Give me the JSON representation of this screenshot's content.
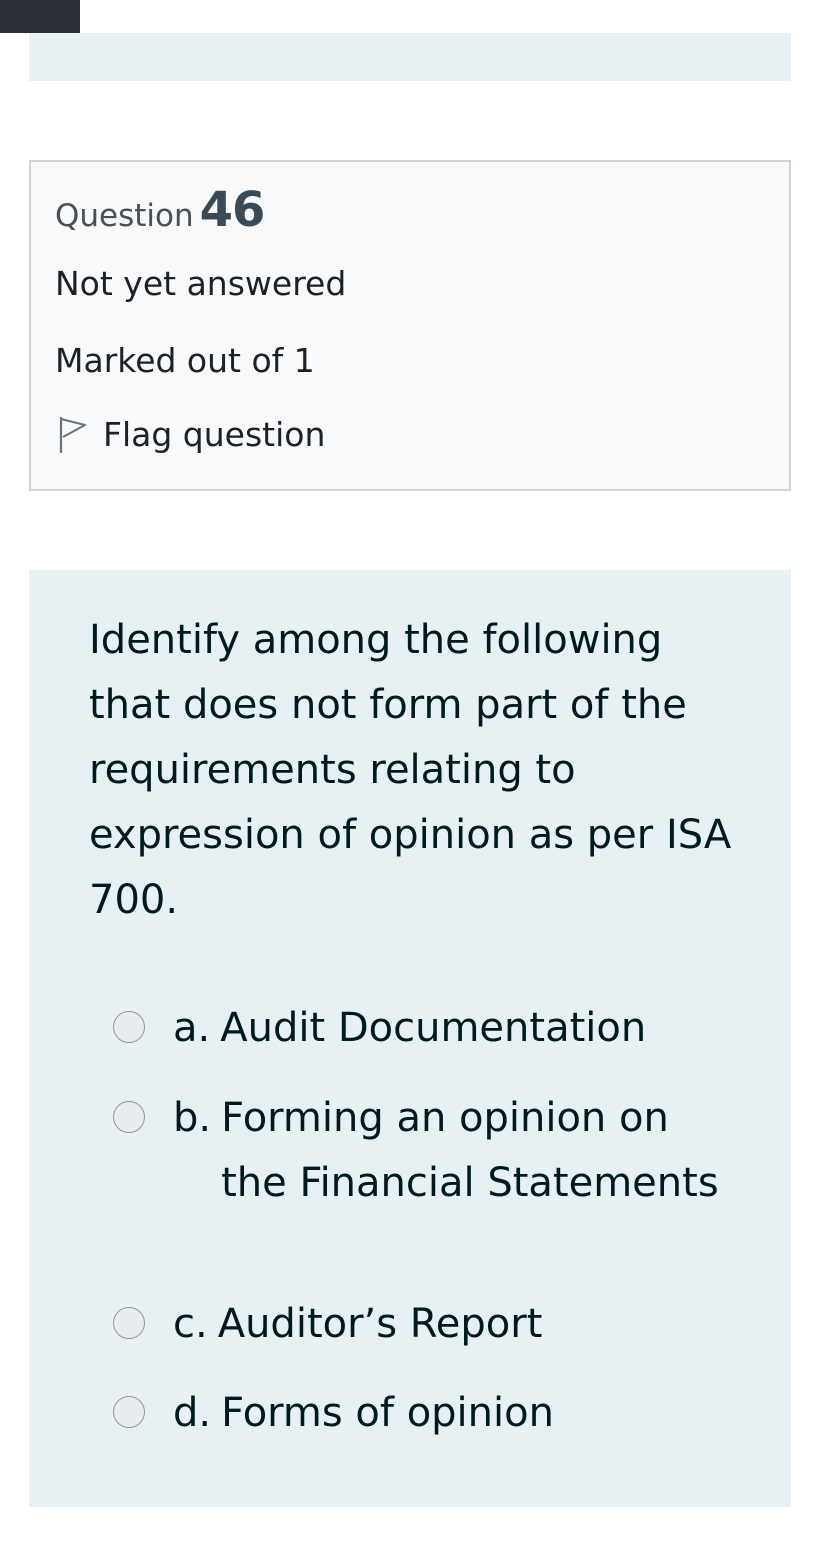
{
  "question": {
    "label": "Question",
    "number": "46",
    "state": "Not yet answered",
    "grade": "Marked out of 1",
    "flag_label": "Flag question",
    "text": "Identify among the following that does not form part of the requirements relating to expression of opinion as per ISA 700.",
    "answers": [
      {
        "letter": "a.",
        "text": "Audit Documentation"
      },
      {
        "letter": "b.",
        "text": "Forming an opinion on the Financial Statements"
      },
      {
        "letter": "c.",
        "text": "Auditor’s Report"
      },
      {
        "letter": "d.",
        "text": "Forms of opinion"
      }
    ]
  },
  "colors": {
    "panel_background": "#e7f1f3",
    "info_background": "#f7f9fa",
    "info_border": "#ced4da",
    "text": "#1d2125"
  },
  "icons": {
    "flag": "flag-outline-icon"
  }
}
